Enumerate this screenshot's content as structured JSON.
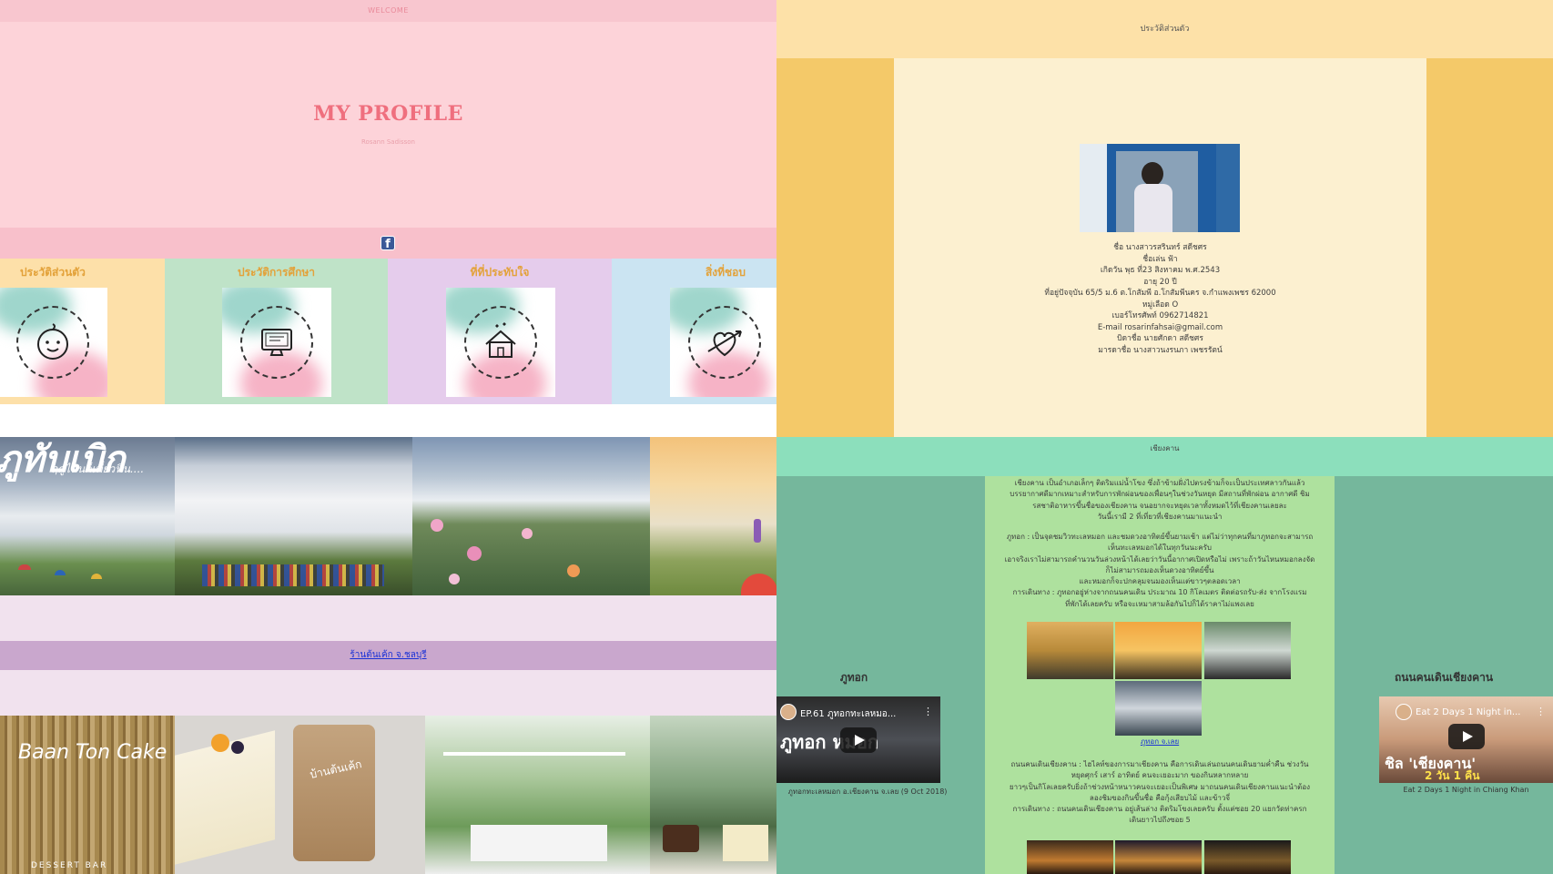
{
  "top_left": {
    "welcome": "WELCOME",
    "title": "MY PROFILE",
    "subtitle": "Rosann Sadisson",
    "facebook_icon": "f",
    "categories": [
      {
        "label": "ประวัติส่วนตัว",
        "icon": "baby-face-icon",
        "bg": "#fde0a9"
      },
      {
        "label": "ประวัติการศึกษา",
        "icon": "computer-monitor-icon",
        "bg": "#bfe3c8"
      },
      {
        "label": "ที่ที่ประทับใจ",
        "icon": "house-hearts-icon",
        "bg": "#e5ccec"
      },
      {
        "label": "สิ่งที่ชอบ",
        "icon": "heart-arrow-icon",
        "bg": "#cbe4f2"
      }
    ],
    "photo_banner_text": "ภูทับเบิก",
    "photo_banner_sub": "ฤดูไหนก็เที่ยวฟิน....",
    "cafe_link": "ร้านต้นเค้ก จ.ชลบุรี",
    "cafe_sign": "Baan Ton Cake",
    "cafe_sign_sub": "DESSERT BAR",
    "cafe_cup_text": "บ้านต้นเค้ก"
  },
  "profile": {
    "header": "ประวัติส่วนตัว",
    "lines": [
      "ชื่อ นางสาวรสรินทร์ สดีชศร",
      "ชื่อเล่น ฟ้า",
      "เกิดวัน พุธ ที่23 สิงหาคม พ.ศ.2543",
      "อายุ 20 ปี",
      "ที่อยู่ปัจจุบัน 65/5 ม.6 ต.โกสัมพี อ.โกสัมพีนคร จ.กำแพงเพชร 62000",
      "หมู่เลือด O",
      "เบอร์โทรศัพท์ 0962714821",
      "E-mail rosarinfahsai@gmail.com",
      "บิดาชื่อ นายศักดา สดีชศร",
      "มารดาชื่อ นางสาวนงรนภา เพชรรัตน์"
    ]
  },
  "chiang_khan": {
    "header": "เชียงคาน",
    "intro": [
      "เชียงคาน เป็นอำเภอเล็กๆ ติดริมแม่น้ำโขง ซึ่งถ้าข้ามฝั่งไปตรงข้ามก็จะเป็นประเทศลาวกันแล้ว",
      "บรรยากาศดีมากเหมาะสำหรับการพักผ่อนของเพื่อนๆในช่วงวันหยุด มีสถานที่พักผ่อน อากาศดี ชิม",
      "รสชาติอาหารขึ้นชื่อของเชียงคาน จนอยากจะหยุดเวลาทั้งหมดไว้ที่เชียงคานเลยละ",
      "วันนี้เรามี 2 ที่เที่ยวที่เชียงคานมาแนะนำ"
    ],
    "phu_tok": [
      "ภูทอก : เป็นจุดชมวิวทะเลหมอก และชมดวงอาทิตย์ขึ้นยามเช้า แต่ไม่ว่าทุกคนที่มาภูทอกจะสามารถ",
      "เห็นทะเลหมอกได้ในทุกวันนะครับ",
      "เอาจริงเราไม่สามารถคำนวนวันล่วงหน้าได้เลยว่าวันนี้อากาศเปิดหรือไม่ เพราะถ้าวันไหนหมอกลงจัด",
      "ก็ไม่สามารถมองเห็นดวงอาทิตย์ขึ้น",
      "และหมอกก็จะปกคลุมจนมองเห็นแต่ขาวๆตลอดเวลา",
      "การเดินทาง : ภูทอกอยู่ห่างจากถนนคนเดิน ประมาณ 10 กิโลเมตร ติดต่อรถรับ-ส่ง จากโรงแรม",
      "ที่พักได้เลยครับ หรือจะเหมาสามล้อกันไปก็ได้ราคาไม่แพงเลย"
    ],
    "phu_tok_link": "ภูทอก จ.เลย",
    "walking_street": [
      "ถนนคนเดินเชียงคาน : ไฮไลท์ของการมาเชียงคาน คือการเดินเล่นถนนคนเดินยามค่ำคืน ช่วงวัน",
      "หยุดศุกร์ เสาร์ อาทิตย์ คนจะเยอะมาก ของกินหลากหลาย",
      "ยาวๆเป็นกิโลเลยครับยิ่งถ้าช่วงหน้าหนาวคนจะเยอะเป็นพิเศษ มาถนนคนเดินเชียงคานแนะนำต้อง",
      "ลองชิมของกินขึ้นชื่อ คือกุ้งเสียบไม้ และข้าวจี่",
      "การเดินทาง : ถนนคนเดินเชียงคาน อยู่เส้นล่าง ติดริมโขงเลยครับ ตั้งแต่ซอย 20 แยกวัดท่าครก",
      "เดินยาวไปถึงซอย 5"
    ],
    "left_title": "ภูทอก",
    "left_video_title": "EP.61 ภูทอกทะเลหมอ...",
    "left_video_overlay": "ภูทอก  หมอก",
    "left_video_caption": "ภูทอกทะเลหมอก อ.เชียงคาน จ.เลย (9 Oct 2018)",
    "right_title": "ถนนคนเดินเชียงคาน",
    "right_video_title": "Eat 2 Days 1 Night in...",
    "right_video_overlay": "ชิล 'เชียงคาน'",
    "right_video_badge": "2 วัน 1 คืน",
    "right_video_caption": "Eat 2 Days 1 Night in Chiang Khan"
  }
}
